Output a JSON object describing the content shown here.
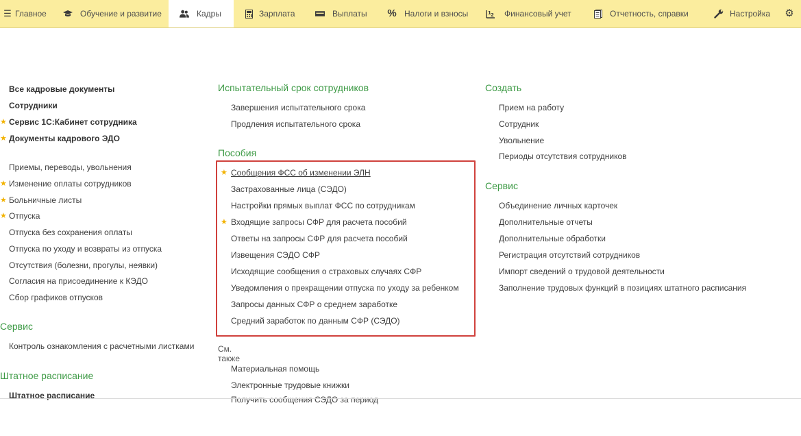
{
  "colors": {
    "topbar": "#fbed9e",
    "group_header": "#3d9a45",
    "star": "#f2b200",
    "highlight_box": "#d0413c"
  },
  "tabs": [
    {
      "icon": "menu-icon",
      "label": "Главное"
    },
    {
      "icon": "graduation-cap-icon",
      "label": "Обучение и развитие"
    },
    {
      "icon": "people-icon",
      "label": "Кадры"
    },
    {
      "icon": "calculator-icon",
      "label": "Зарплата"
    },
    {
      "icon": "cash-icon",
      "label": "Выплаты"
    },
    {
      "icon": "percent-icon",
      "label": "Налоги и взносы"
    },
    {
      "icon": "finance-chart-icon",
      "label": "Финансовый учет"
    },
    {
      "icon": "report-icon",
      "label": "Отчетность, справки"
    },
    {
      "icon": "wrench-icon",
      "label": "Настройка"
    },
    {
      "icon": "gear-icon",
      "label": ""
    }
  ],
  "left": {
    "top_links": [
      "Все кадровые документы",
      "Сотрудники",
      "Сервис 1С:Кабинет сотрудника",
      "Документы кадрового ЭДО"
    ],
    "links": [
      "Приемы, переводы, увольнения",
      "Изменение оплаты сотрудников",
      "Больничные листы",
      "Отпуска",
      "Отпуска без сохранения оплаты",
      "Отпуска по уходу и возвраты из отпуска",
      "Отсутствия (болезни, прогулы, неявки)",
      "Согласия на присоединение к КЭДО",
      "Сбор графиков отпусков"
    ],
    "service_header": "Сервис",
    "service_links": [
      "Контроль ознакомления с расчетными листками"
    ],
    "staff_header": "Штатное расписание",
    "staff_links": [
      "Штатное расписание"
    ]
  },
  "middle": {
    "probation_header": "Испытательный срок сотрудников",
    "probation_links": [
      "Завершения испытательного срока",
      "Продления испытательного срока"
    ],
    "benefits_header": "Пособия",
    "benefits_links": [
      "Сообщения ФСС об изменении ЭЛН",
      "Застрахованные лица (СЭДО)",
      "Настройки прямых выплат ФСС по сотрудникам",
      "Входящие запросы СФР для расчета пособий",
      "Ответы на запросы СФР для расчета пособий",
      "Извещения СЭДО СФР",
      "Исходящие сообщения о страховых случаях СФР",
      "Уведомления о прекращении отпуска по уходу за ребенком",
      "Запросы данных СФР о среднем заработке",
      "Средний заработок по данным СФР (СЭДО)"
    ],
    "see_also_label": "См. также",
    "see_also_links": [
      "Материальная помощь",
      "Электронные трудовые книжки",
      "Получить сообщения СЭДО за период"
    ]
  },
  "right": {
    "create_header": "Создать",
    "create_links": [
      "Прием на работу",
      "Сотрудник",
      "Увольнение",
      "Периоды отсутствия сотрудников"
    ],
    "service_header": "Сервис",
    "service_links": [
      "Объединение личных карточек",
      "Дополнительные отчеты",
      "Дополнительные обработки",
      "Регистрация отсутствий сотрудников",
      "Импорт сведений о трудовой деятельности",
      "Заполнение трудовых функций в позициях штатного расписания"
    ]
  }
}
